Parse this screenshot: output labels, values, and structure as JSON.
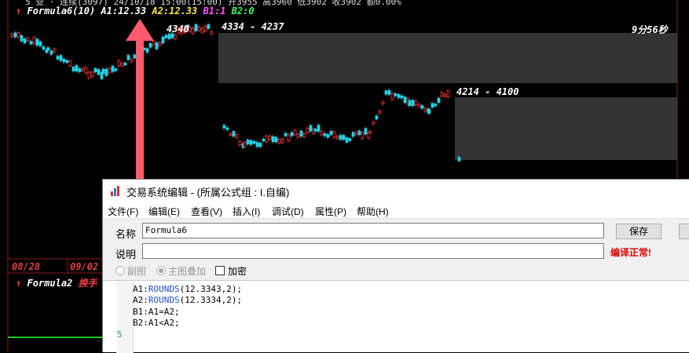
{
  "chart": {
    "top_strip_text": "5 亚 · 连续(3097) 24/10/18 15:00(15:00) 开3955 高3960 低3902 收3902 额0.00%",
    "formula_main": {
      "name": "Formula6(10)",
      "a1_label": "A1:",
      "a1_value": "12.33",
      "a2_label": "A2:",
      "a2_value": "12.33",
      "b1_label": "B1:",
      "b1_value": "1",
      "b2_label": "B2:",
      "b2_value": "0"
    },
    "annotations": {
      "price_4340": "4340",
      "range_1": "4334 - 4237",
      "range_2": "4214 - 4100",
      "timer": "9分56秒"
    },
    "dates": [
      "08/28",
      "09/02"
    ],
    "formula_sub": {
      "name": "Formula2",
      "suffix": "换手"
    },
    "colors": {
      "up": "#ff3333",
      "down": "#22d3e6",
      "formula_white": "#ffffff",
      "a2_yellow": "#f5e342",
      "b1_magenta": "#ff55ff",
      "b2_green": "#33ff55",
      "arrow": "#ff5a6e"
    }
  },
  "dialog": {
    "title": "交易系统编辑 - (所属公式组 : I.自编)",
    "menu": [
      "文件(F)",
      "编辑(E)",
      "查看(V)",
      "插入(I)",
      "调试(D)",
      "属性(P)",
      "帮助(H)"
    ],
    "name_label": "名称",
    "name_value": "Formula6",
    "desc_label": "说明",
    "desc_value": "",
    "save_button": "保存",
    "compile_status": "编译正常!",
    "options": {
      "sub_chart": "副图",
      "main_overlay": "主图叠加",
      "encrypt": "加密"
    },
    "code_lines": [
      {
        "pre": "A1:",
        "fn": "ROUNDS",
        "post": "(12.3343,2);"
      },
      {
        "pre": "A2:",
        "fn": "ROUNDS",
        "post": "(12.3334,2);"
      },
      {
        "pre": "B1:A1=A2;",
        "fn": "",
        "post": ""
      },
      {
        "pre": "B2:A1<A2;",
        "fn": "",
        "post": ""
      }
    ],
    "line_number": "5"
  }
}
